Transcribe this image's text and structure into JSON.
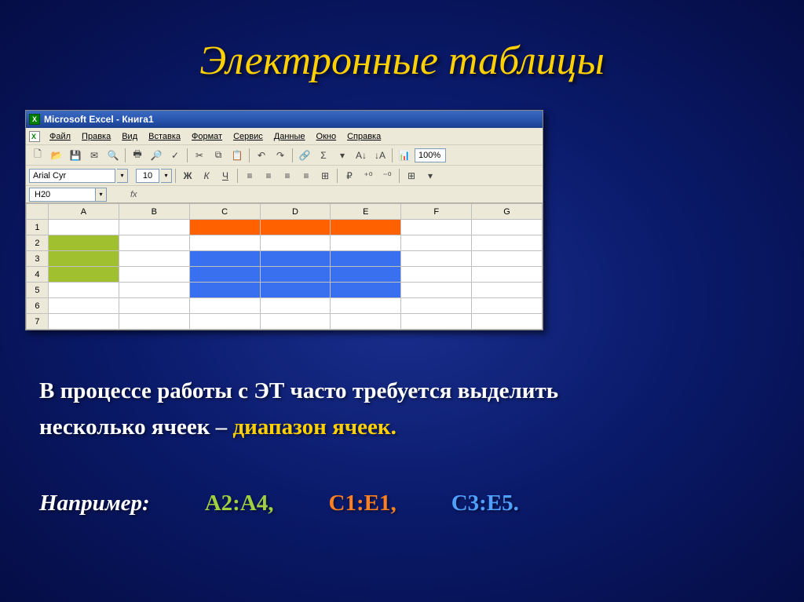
{
  "slide": {
    "title": "Электронные таблицы",
    "body_line1": "В процессе работы с ЭТ часто требуется выделить",
    "body_line2_a": "несколько ячеек – ",
    "body_line2_b": "диапазон ячеек.",
    "example_label": "Например:",
    "example_green": "А2:А4,",
    "example_orange": "С1:Е1,",
    "example_blue": "С3:Е5."
  },
  "excel": {
    "title": "Microsoft Excel - Книга1",
    "icon_letter": "X",
    "menus": [
      "Файл",
      "Правка",
      "Вид",
      "Вставка",
      "Формат",
      "Сервис",
      "Данные",
      "Окно",
      "Справка"
    ],
    "font_name": "Arial Cyr",
    "font_size": "10",
    "zoom": "100%",
    "bold": "Ж",
    "italic": "К",
    "underline": "Ч",
    "name_box": "H20",
    "fx": "fx",
    "columns": [
      "A",
      "B",
      "C",
      "D",
      "E",
      "F",
      "G"
    ],
    "rows": [
      "1",
      "2",
      "3",
      "4",
      "5",
      "6",
      "7"
    ]
  },
  "icons": {
    "new": "🗋",
    "open": "📂",
    "save": "💾",
    "mail": "✉",
    "search_doc": "🔍",
    "print": "🖶",
    "preview": "🔎",
    "spell": "✓",
    "cut": "✂",
    "copy": "⧉",
    "paste": "📋",
    "undo": "↶",
    "redo": "↷",
    "link": "🔗",
    "sum": "Σ",
    "sort_asc": "A↓",
    "sort_desc": "↓A",
    "chart": "📊",
    "align_left": "≡",
    "align_center": "≡",
    "align_right": "≡",
    "align_just": "≡",
    "merge": "⊞",
    "currency": "₽",
    "inc_dec": "⁺⁰",
    "dec_dec": "⁻⁰",
    "borders": "⊞",
    "dropdown": "▾"
  }
}
